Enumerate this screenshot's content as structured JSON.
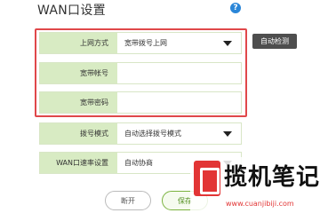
{
  "header": {
    "title": "WAN口设置",
    "help_icon": "?"
  },
  "form": {
    "access_mode": {
      "label": "上网方式",
      "value": "宽带拨号上网"
    },
    "account": {
      "label": "宽带帐号",
      "value": ""
    },
    "password": {
      "label": "宽带密码",
      "value": ""
    },
    "dial_mode": {
      "label": "拨号模式",
      "value": "自动选择拨号模式"
    },
    "wan_speed": {
      "label": "WAN口速率设置",
      "value": "自动协商"
    }
  },
  "buttons": {
    "auto_detect": "自动检测",
    "disconnect": "断开",
    "save": "保存"
  },
  "watermark": {
    "title": "揽机笔记",
    "url": "www.cuanjibiji.com"
  },
  "colors": {
    "highlight": "#e0484a",
    "label_bg": "#d8ebc3",
    "row_border": "#d8e6c6",
    "save_green": "#7bb33f",
    "help_blue": "#2a86d8",
    "dark_button": "#4e4e4e"
  }
}
